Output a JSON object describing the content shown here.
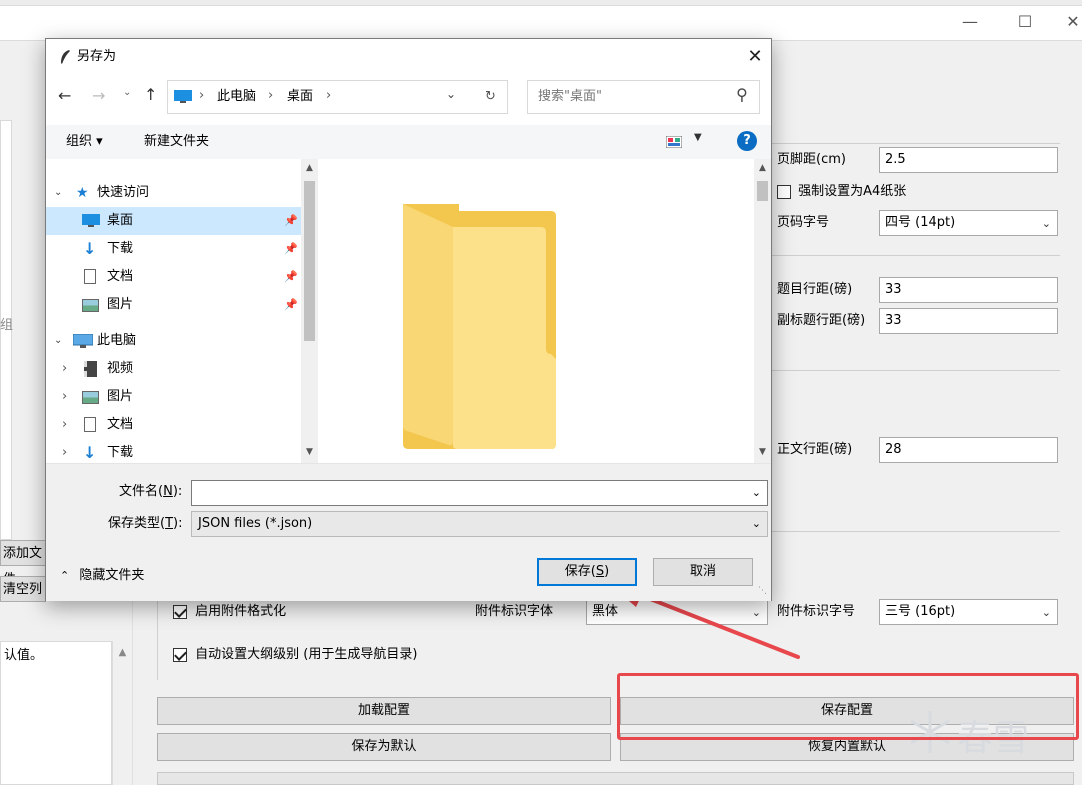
{
  "background_app": {
    "config": {
      "footer_margin_label": "页脚距(cm)",
      "footer_margin_value": "2.5",
      "force_a4_label": "强制设置为A4纸张",
      "force_a4_checked": false,
      "page_number_size_label": "页码字号",
      "page_number_size_value": "四号 (14pt)",
      "title_line_spacing_label": "题目行距(磅)",
      "title_line_spacing_value": "33",
      "subtitle_line_spacing_label": "副标题行距(磅)",
      "subtitle_line_spacing_value": "33",
      "body_line_spacing_label": "正文行距(磅)",
      "body_line_spacing_value": "28",
      "attachment_format_label": "启用附件格式化",
      "attachment_format_checked": true,
      "attachment_font_label": "附件标识字体",
      "attachment_font_value": "黑体",
      "attachment_size_label": "附件标识字号",
      "attachment_size_value": "三号 (16pt)",
      "outline_level_label": "自动设置大纲级别 (用于生成导航目录)",
      "outline_level_checked": true
    },
    "buttons": {
      "load_config": "加载配置",
      "save_config": "保存配置",
      "save_as_default": "保存为默认",
      "restore_default": "恢复内置默认"
    },
    "left": {
      "partial_glyph": "组",
      "add_file_partial": "添加文件",
      "clear_list_partial": "清空列",
      "log_text_partial": "认值。"
    },
    "watermark": "春雪"
  },
  "dialog": {
    "title": "另存为",
    "address": {
      "crumbs": [
        "此电脑",
        "桌面"
      ]
    },
    "search_placeholder": "搜索\"桌面\"",
    "toolbar": {
      "organize": "组织 ▾",
      "new_folder": "新建文件夹"
    },
    "nav_tree": {
      "quick_access": "快速访问",
      "quick_items": [
        "桌面",
        "下载",
        "文档",
        "图片"
      ],
      "this_pc": "此电脑",
      "pc_items": [
        "视频",
        "图片",
        "文档",
        "下载"
      ]
    },
    "filename_label": "文件名(",
    "filename_accel": "N",
    "filename_label_end": "):",
    "filename_value": "",
    "filetype_label": "保存类型(",
    "filetype_accel": "T",
    "filetype_label_end": "):",
    "filetype_value": "JSON files (*.json)",
    "hide_folders": "隐藏文件夹",
    "save_btn_pre": "保存(",
    "save_btn_accel": "S",
    "save_btn_post": ")",
    "cancel_btn": "取消"
  },
  "colors": {
    "accent": "#0078d7",
    "annotation": "#e8474c",
    "selection": "#cce8ff",
    "folder": "#f8d774"
  }
}
